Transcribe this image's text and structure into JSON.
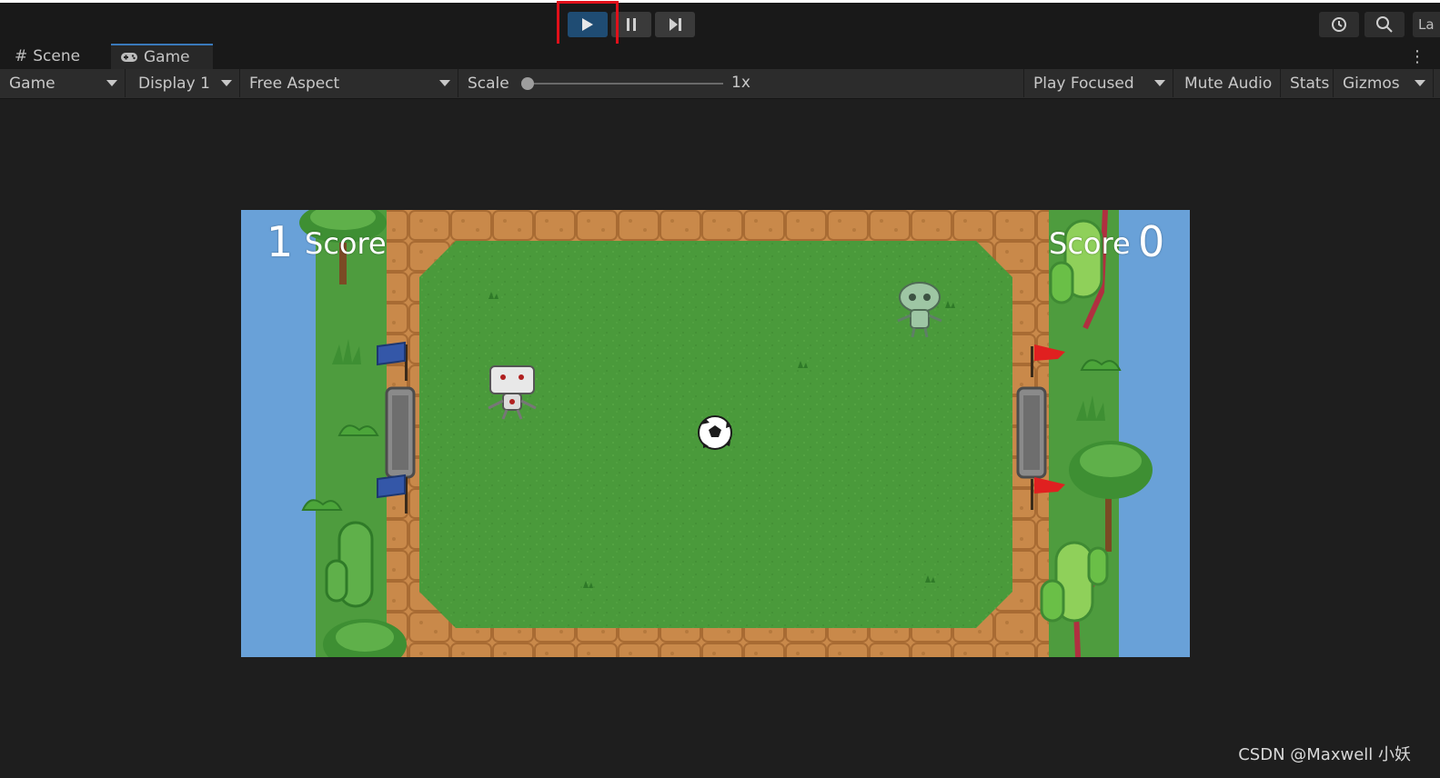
{
  "toolbar": {
    "play_icon": "play-icon",
    "pause_icon": "pause-icon",
    "step_icon": "step-icon",
    "history_icon": "history-icon",
    "search_icon": "search-icon",
    "layers_label": "La",
    "highlight_color": "#e0101a",
    "play_active_color": "#1f4c73"
  },
  "tabs": [
    {
      "label": "Scene",
      "icon": "grid-icon"
    },
    {
      "label": "Game",
      "icon": "gamepad-icon",
      "active": true
    }
  ],
  "controls": {
    "view": "Game",
    "display": "Display 1",
    "aspect": "Free Aspect",
    "scale_label": "Scale",
    "scale_value": "1x",
    "play_mode": "Play Focused",
    "mute": "Mute Audio",
    "stats": "Stats",
    "gizmos": "Gizmos"
  },
  "game": {
    "left_score": "1",
    "left_label": "Score",
    "right_label": "Score",
    "right_score": "0",
    "colors": {
      "grass": "#4a9a3b",
      "water": "#69a1d8",
      "dirt": "#c9894a",
      "blue_flag": "#3457a8",
      "red_flag": "#e02020"
    }
  },
  "watermark": "CSDN @Maxwell 小妖"
}
